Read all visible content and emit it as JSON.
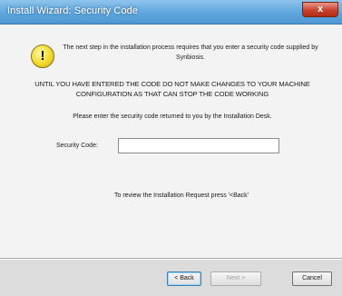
{
  "window": {
    "title": "Install Wizard: Security Code",
    "close_label": "x"
  },
  "message": {
    "intro": "The next step in the installation process requires that you enter a security code supplied by Synbiosis.",
    "warning": "UNTIL YOU HAVE ENTERED THE CODE DO NOT MAKE CHANGES TO YOUR MACHINE CONFIGURATION AS THAT CAN STOP THE CODE WORKING",
    "instruction": "Please enter the security code returned to you by the Installation Desk.",
    "review_hint": "To review the Installation Request press '<Back'"
  },
  "form": {
    "security_code_label": "Security Code:",
    "security_code_value": ""
  },
  "buttons": {
    "back": "< Back",
    "next": "Next >",
    "cancel": "Cancel"
  },
  "icons": {
    "warning": "warning-icon"
  },
  "colors": {
    "titlebar": "#5fa6de",
    "content_bg": "#f3f3f3",
    "warning_icon": "#f3d92b"
  }
}
